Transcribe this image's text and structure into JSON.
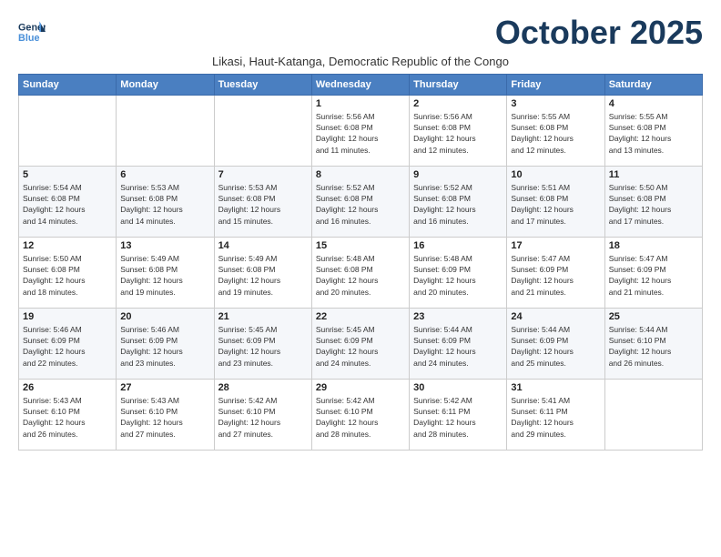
{
  "logo": {
    "line1": "General",
    "line2": "Blue"
  },
  "title": "October 2025",
  "subtitle": "Likasi, Haut-Katanga, Democratic Republic of the Congo",
  "headers": [
    "Sunday",
    "Monday",
    "Tuesday",
    "Wednesday",
    "Thursday",
    "Friday",
    "Saturday"
  ],
  "weeks": [
    [
      {
        "num": "",
        "detail": ""
      },
      {
        "num": "",
        "detail": ""
      },
      {
        "num": "",
        "detail": ""
      },
      {
        "num": "1",
        "detail": "Sunrise: 5:56 AM\nSunset: 6:08 PM\nDaylight: 12 hours\nand 11 minutes."
      },
      {
        "num": "2",
        "detail": "Sunrise: 5:56 AM\nSunset: 6:08 PM\nDaylight: 12 hours\nand 12 minutes."
      },
      {
        "num": "3",
        "detail": "Sunrise: 5:55 AM\nSunset: 6:08 PM\nDaylight: 12 hours\nand 12 minutes."
      },
      {
        "num": "4",
        "detail": "Sunrise: 5:55 AM\nSunset: 6:08 PM\nDaylight: 12 hours\nand 13 minutes."
      }
    ],
    [
      {
        "num": "5",
        "detail": "Sunrise: 5:54 AM\nSunset: 6:08 PM\nDaylight: 12 hours\nand 14 minutes."
      },
      {
        "num": "6",
        "detail": "Sunrise: 5:53 AM\nSunset: 6:08 PM\nDaylight: 12 hours\nand 14 minutes."
      },
      {
        "num": "7",
        "detail": "Sunrise: 5:53 AM\nSunset: 6:08 PM\nDaylight: 12 hours\nand 15 minutes."
      },
      {
        "num": "8",
        "detail": "Sunrise: 5:52 AM\nSunset: 6:08 PM\nDaylight: 12 hours\nand 16 minutes."
      },
      {
        "num": "9",
        "detail": "Sunrise: 5:52 AM\nSunset: 6:08 PM\nDaylight: 12 hours\nand 16 minutes."
      },
      {
        "num": "10",
        "detail": "Sunrise: 5:51 AM\nSunset: 6:08 PM\nDaylight: 12 hours\nand 17 minutes."
      },
      {
        "num": "11",
        "detail": "Sunrise: 5:50 AM\nSunset: 6:08 PM\nDaylight: 12 hours\nand 17 minutes."
      }
    ],
    [
      {
        "num": "12",
        "detail": "Sunrise: 5:50 AM\nSunset: 6:08 PM\nDaylight: 12 hours\nand 18 minutes."
      },
      {
        "num": "13",
        "detail": "Sunrise: 5:49 AM\nSunset: 6:08 PM\nDaylight: 12 hours\nand 19 minutes."
      },
      {
        "num": "14",
        "detail": "Sunrise: 5:49 AM\nSunset: 6:08 PM\nDaylight: 12 hours\nand 19 minutes."
      },
      {
        "num": "15",
        "detail": "Sunrise: 5:48 AM\nSunset: 6:08 PM\nDaylight: 12 hours\nand 20 minutes."
      },
      {
        "num": "16",
        "detail": "Sunrise: 5:48 AM\nSunset: 6:09 PM\nDaylight: 12 hours\nand 20 minutes."
      },
      {
        "num": "17",
        "detail": "Sunrise: 5:47 AM\nSunset: 6:09 PM\nDaylight: 12 hours\nand 21 minutes."
      },
      {
        "num": "18",
        "detail": "Sunrise: 5:47 AM\nSunset: 6:09 PM\nDaylight: 12 hours\nand 21 minutes."
      }
    ],
    [
      {
        "num": "19",
        "detail": "Sunrise: 5:46 AM\nSunset: 6:09 PM\nDaylight: 12 hours\nand 22 minutes."
      },
      {
        "num": "20",
        "detail": "Sunrise: 5:46 AM\nSunset: 6:09 PM\nDaylight: 12 hours\nand 23 minutes."
      },
      {
        "num": "21",
        "detail": "Sunrise: 5:45 AM\nSunset: 6:09 PM\nDaylight: 12 hours\nand 23 minutes."
      },
      {
        "num": "22",
        "detail": "Sunrise: 5:45 AM\nSunset: 6:09 PM\nDaylight: 12 hours\nand 24 minutes."
      },
      {
        "num": "23",
        "detail": "Sunrise: 5:44 AM\nSunset: 6:09 PM\nDaylight: 12 hours\nand 24 minutes."
      },
      {
        "num": "24",
        "detail": "Sunrise: 5:44 AM\nSunset: 6:09 PM\nDaylight: 12 hours\nand 25 minutes."
      },
      {
        "num": "25",
        "detail": "Sunrise: 5:44 AM\nSunset: 6:10 PM\nDaylight: 12 hours\nand 26 minutes."
      }
    ],
    [
      {
        "num": "26",
        "detail": "Sunrise: 5:43 AM\nSunset: 6:10 PM\nDaylight: 12 hours\nand 26 minutes."
      },
      {
        "num": "27",
        "detail": "Sunrise: 5:43 AM\nSunset: 6:10 PM\nDaylight: 12 hours\nand 27 minutes."
      },
      {
        "num": "28",
        "detail": "Sunrise: 5:42 AM\nSunset: 6:10 PM\nDaylight: 12 hours\nand 27 minutes."
      },
      {
        "num": "29",
        "detail": "Sunrise: 5:42 AM\nSunset: 6:10 PM\nDaylight: 12 hours\nand 28 minutes."
      },
      {
        "num": "30",
        "detail": "Sunrise: 5:42 AM\nSunset: 6:11 PM\nDaylight: 12 hours\nand 28 minutes."
      },
      {
        "num": "31",
        "detail": "Sunrise: 5:41 AM\nSunset: 6:11 PM\nDaylight: 12 hours\nand 29 minutes."
      },
      {
        "num": "",
        "detail": ""
      }
    ]
  ]
}
